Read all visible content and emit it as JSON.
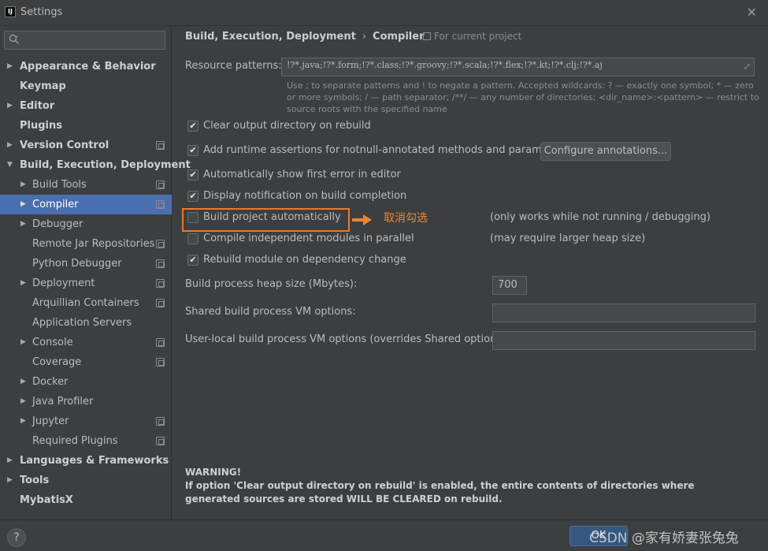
{
  "window": {
    "title": "Settings",
    "app_icon_text": "IJ"
  },
  "sidebar": {
    "search_placeholder": "",
    "items": [
      {
        "label": "Appearance & Behavior",
        "arrow": "▶"
      },
      {
        "label": "Keymap",
        "arrow": ""
      },
      {
        "label": "Editor",
        "arrow": "▶"
      },
      {
        "label": "Plugins",
        "arrow": ""
      },
      {
        "label": "Version Control",
        "arrow": "▶"
      },
      {
        "label": "Build, Execution, Deployment",
        "arrow": "▼"
      },
      {
        "label": "Build Tools",
        "arrow": "▶"
      },
      {
        "label": "Compiler",
        "arrow": "▶"
      },
      {
        "label": "Debugger",
        "arrow": "▶"
      },
      {
        "label": "Remote Jar Repositories",
        "arrow": ""
      },
      {
        "label": "Python Debugger",
        "arrow": ""
      },
      {
        "label": "Deployment",
        "arrow": "▶"
      },
      {
        "label": "Arquillian Containers",
        "arrow": ""
      },
      {
        "label": "Application Servers",
        "arrow": ""
      },
      {
        "label": "Console",
        "arrow": "▶"
      },
      {
        "label": "Coverage",
        "arrow": ""
      },
      {
        "label": "Docker",
        "arrow": "▶"
      },
      {
        "label": "Java Profiler",
        "arrow": "▶"
      },
      {
        "label": "Jupyter",
        "arrow": "▶"
      },
      {
        "label": "Required Plugins",
        "arrow": ""
      },
      {
        "label": "Languages & Frameworks",
        "arrow": "▶"
      },
      {
        "label": "Tools",
        "arrow": "▶"
      },
      {
        "label": "MybatisX",
        "arrow": ""
      }
    ]
  },
  "main": {
    "breadcrumb": {
      "parent": "Build, Execution, Deployment",
      "separator": "›",
      "current": "Compiler"
    },
    "for_project": "For current project",
    "resource_patterns": {
      "label": "Resource patterns:",
      "value": "!?*.java;!?*.form;!?*.class;!?*.groovy;!?*.scala;!?*.flex;!?*.kt;!?*.clj;!?*.aj",
      "hint": "Use ; to separate patterns and ! to negate a pattern. Accepted wildcards: ? — exactly one symbol; * — zero or more symbols; / — path separator; /**/ — any number of directories; <dir_name>:<pattern> — restrict to source roots with the specified name"
    },
    "options": {
      "clear_output": "Clear output directory on rebuild",
      "runtime_assertions": "Add runtime assertions for notnull-annotated methods and parameters",
      "configure_annotations": "Configure annotations...",
      "show_first_error": "Automatically show first error in editor",
      "display_notification": "Display notification on build completion",
      "build_automatically": "Build project automatically",
      "build_automatically_note": "(only works while not running / debugging)",
      "compile_parallel": "Compile independent modules in parallel",
      "compile_parallel_note": "(may require larger heap size)",
      "rebuild_module": "Rebuild module on dependency change"
    },
    "annotation": "取消勾选",
    "heap": {
      "label": "Build process heap size (Mbytes):",
      "value": "700"
    },
    "shared_vm": {
      "label": "Shared build process VM options:",
      "value": ""
    },
    "user_vm": {
      "label": "User-local build process VM options (overrides Shared options):",
      "value": ""
    },
    "warning": {
      "title": "WARNING!",
      "body": "If option 'Clear output directory on rebuild' is enabled, the entire contents of directories where generated sources are stored WILL BE CLEARED on rebuild."
    }
  },
  "footer": {
    "help": "?",
    "ok": "OK",
    "watermark": "CSDN @家有娇妻张兔兔"
  },
  "colors": {
    "selection": "#4b6eaf",
    "annotation": "#f0842c",
    "background": "#3c3f41"
  }
}
